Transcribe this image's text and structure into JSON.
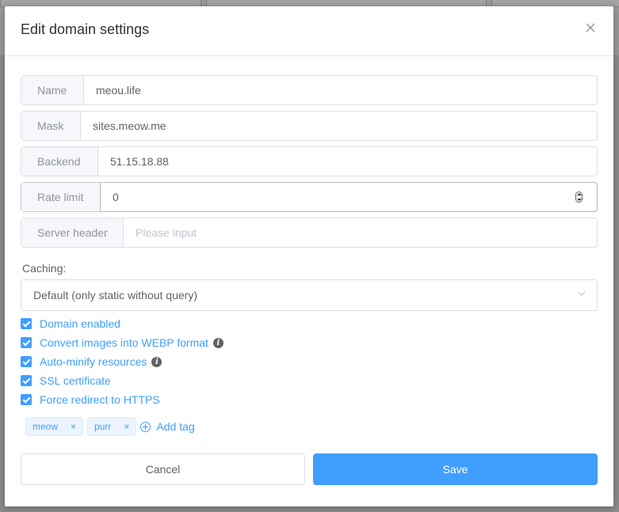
{
  "dialog": {
    "title": "Edit domain settings"
  },
  "fields": {
    "name": {
      "label": "Name",
      "value": "meou.life"
    },
    "mask": {
      "label": "Mask",
      "value": "sites.meow.me"
    },
    "backend": {
      "label": "Backend",
      "value": "51.15.18.88"
    },
    "rate_limit": {
      "label": "Rate limit",
      "value": "0"
    },
    "server_header": {
      "label": "Server header",
      "value": "",
      "placeholder": "Please input"
    }
  },
  "caching": {
    "label": "Caching:",
    "selected": "Default (only static without query)"
  },
  "checkboxes": [
    {
      "label": "Domain enabled",
      "checked": true,
      "info": false
    },
    {
      "label": "Convert images into WEBP format",
      "checked": true,
      "info": true
    },
    {
      "label": "Auto-minify resources",
      "checked": true,
      "info": true
    },
    {
      "label": "SSL certificate",
      "checked": true,
      "info": false
    },
    {
      "label": "Force redirect to HTTPS",
      "checked": true,
      "info": false
    }
  ],
  "tags": [
    {
      "label": "meow"
    },
    {
      "label": "purr"
    }
  ],
  "add_tag_label": "Add tag",
  "buttons": {
    "cancel": "Cancel",
    "save": "Save"
  },
  "colors": {
    "accent": "#409eff",
    "overlay": "#8c8c8c"
  }
}
